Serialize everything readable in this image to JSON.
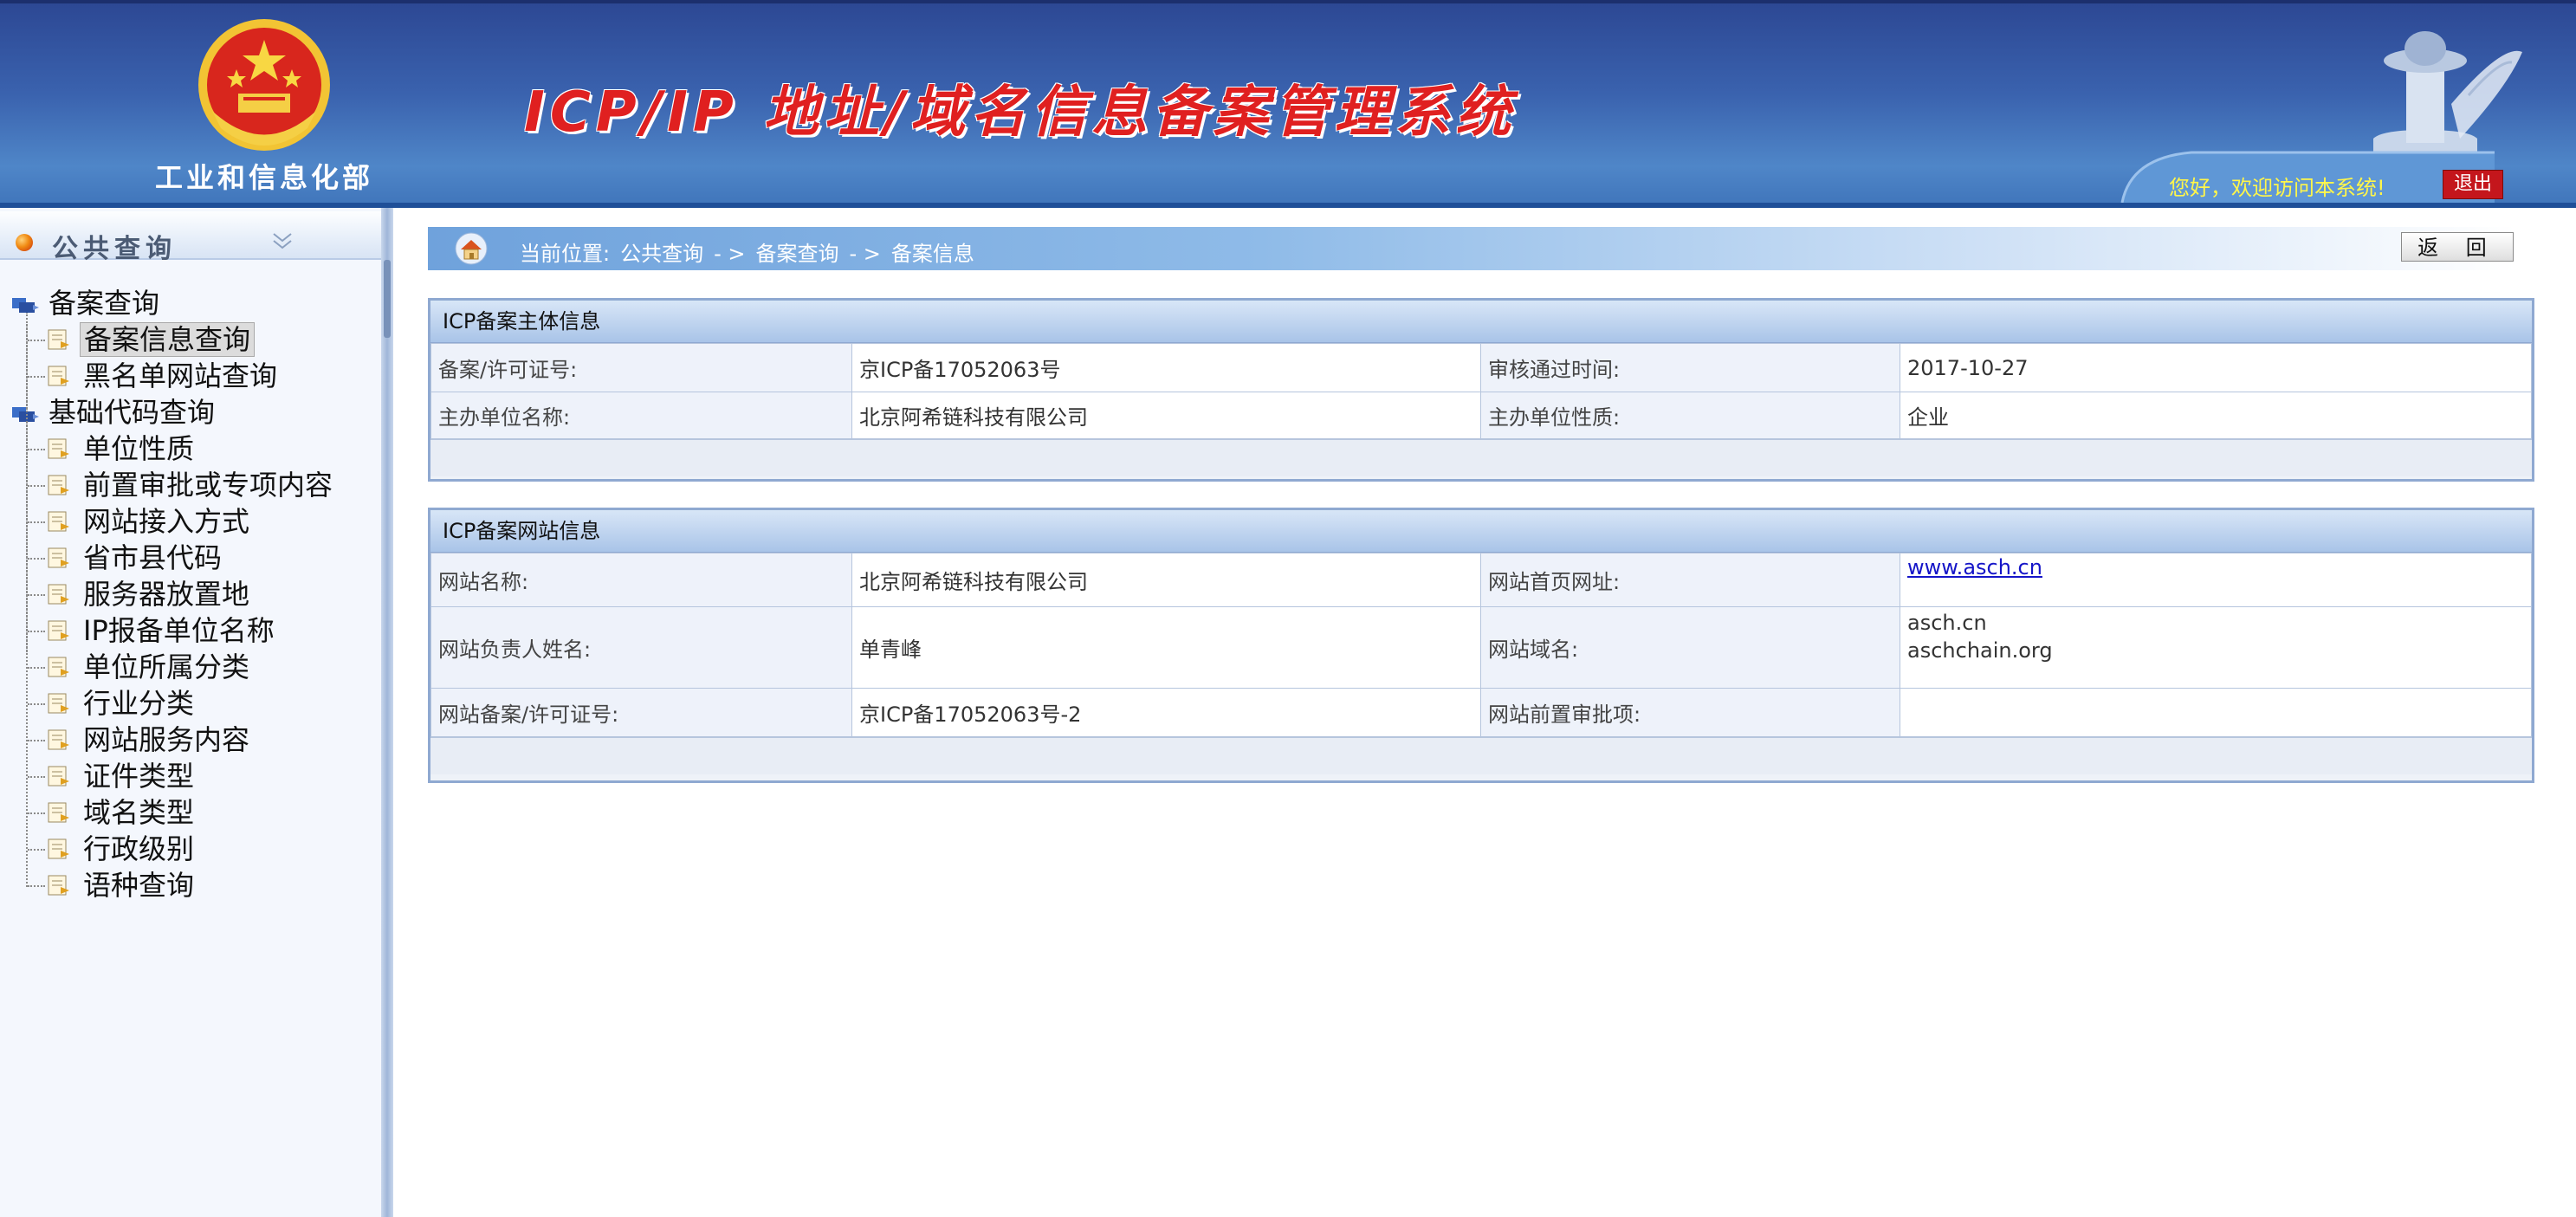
{
  "header": {
    "ministry": "工业和信息化部",
    "system_title": "ICP/IP 地址/域名信息备案管理系统",
    "welcome": "您好，欢迎访问本系统!",
    "logout": "退出"
  },
  "sidebar": {
    "title": "公共查询",
    "groups": [
      {
        "label": "备案查询",
        "items": [
          "备案信息查询",
          "黑名单网站查询"
        ]
      },
      {
        "label": "基础代码查询",
        "items": [
          "单位性质",
          "前置审批或专项内容",
          "网站接入方式",
          "省市县代码",
          "服务器放置地",
          "IP报备单位名称",
          "单位所属分类",
          "行业分类",
          "网站服务内容",
          "证件类型",
          "域名类型",
          "行政级别",
          "语种查询"
        ]
      }
    ],
    "selected": "备案信息查询"
  },
  "breadcrumb": {
    "prefix": "当前位置:",
    "items": [
      "公共查询",
      "备案查询",
      "备案信息"
    ],
    "separator": "- >",
    "back": "返 回"
  },
  "subject_panel": {
    "title": "ICP备案主体信息",
    "license_label": "备案/许可证号:",
    "license_value": "京ICP备17052063号",
    "approval_label": "审核通过时间:",
    "approval_value": "2017-10-27",
    "org_label": "主办单位名称:",
    "org_value": "北京阿希链科技有限公司",
    "nature_label": "主办单位性质:",
    "nature_value": "企业"
  },
  "website_panel": {
    "title": "ICP备案网站信息",
    "site_name_label": "网站名称:",
    "site_name_value": "北京阿希链科技有限公司",
    "homepage_label": "网站首页网址:",
    "homepage_value": "www.asch.cn",
    "owner_label": "网站负责人姓名:",
    "owner_value": "单青峰",
    "domain_label": "网站域名:",
    "domains": [
      "asch.cn",
      "aschchain.org"
    ],
    "site_license_label": "网站备案/许可证号:",
    "site_license_value": "京ICP备17052063号-2",
    "preapproval_label": "网站前置审批项:",
    "preapproval_value": ""
  }
}
